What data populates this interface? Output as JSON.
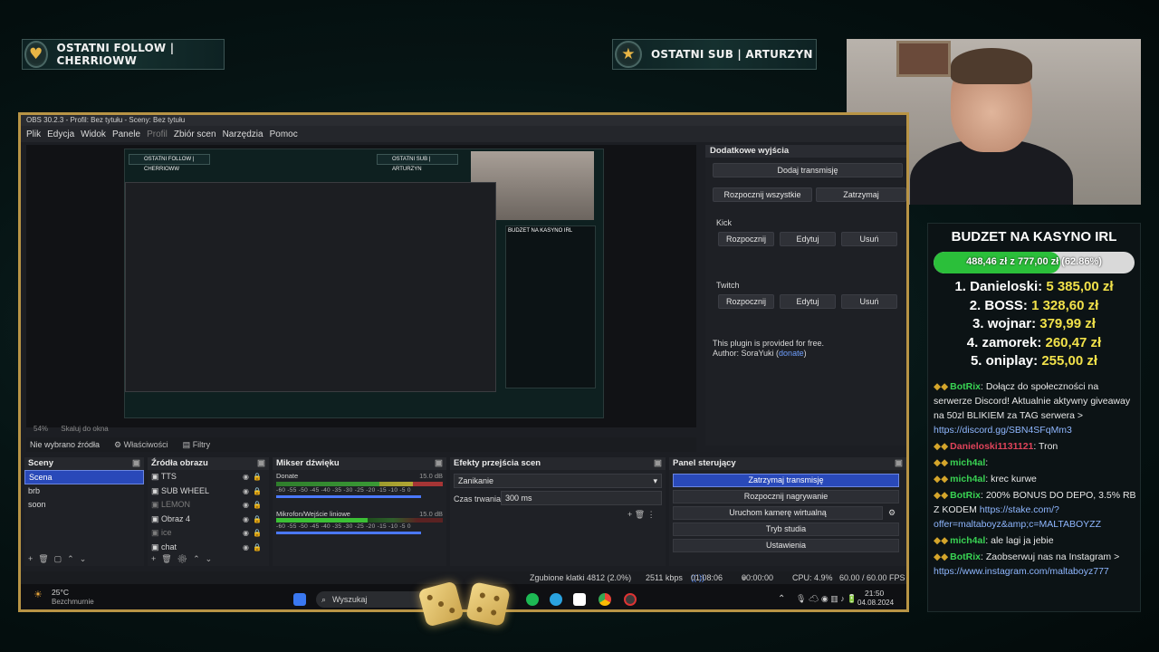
{
  "overlay": {
    "last_follow": "OSTATNI FOLLOW | CHERRIOWW",
    "last_sub": "OSTATNI SUB | ARTURZYN"
  },
  "budget": {
    "title": "BUDZET NA KASYNO IRL",
    "progress_text": "488,46 zł z 777,00 zł (62.86%)",
    "progress_fraction": 0.6286,
    "ranks": [
      {
        "label": "1. Danieloski:",
        "amount": "5 385,00 zł"
      },
      {
        "label": "2. BOSS:",
        "amount": "1 328,60 zł"
      },
      {
        "label": "3. wojnar:",
        "amount": "379,99 zł"
      },
      {
        "label": "4. zamorek:",
        "amount": "260,47 zł"
      },
      {
        "label": "5. oniplay:",
        "amount": "255,00 zł"
      }
    ]
  },
  "chat": [
    {
      "user": "BotRix",
      "user_color": "#39d353",
      "text": ": Dołącz do społeczności na serwerze Discord! Aktualnie aktywny giveaway na 50zl BLIKIEM za TAG serwera >",
      "link": "https://discord.gg/SBN4SFqMm3"
    },
    {
      "user": "Danieloski1131121",
      "user_color": "#e0435a",
      "text": ": Tron",
      "link": ""
    },
    {
      "user": "mich4al",
      "user_color": "#39d353",
      "text": ":",
      "link": ""
    },
    {
      "user": "mich4al",
      "user_color": "#39d353",
      "text": ": krec kurwe",
      "link": ""
    },
    {
      "user": "BotRix",
      "user_color": "#39d353",
      "text": ": 200% BONUS DO DEPO, 3.5% RB Z KODEM",
      "link": "https://stake.com/?offer=maltaboyz&amp;c=MALTABOYZZ"
    },
    {
      "user": "mich4al",
      "user_color": "#39d353",
      "text": ": ale lagi ja jebie",
      "link": ""
    },
    {
      "user": "BotRix",
      "user_color": "#39d353",
      "text": ": Zaobserwuj nas na Instagram >",
      "link": "https://www.instagram.com/maltaboyz777"
    }
  ],
  "obs": {
    "title": "OBS 30.2.3 - Profil: Bez tytułu - Sceny: Bez tytułu",
    "menu": [
      {
        "label": "Plik",
        "dim": false
      },
      {
        "label": "Edycja",
        "dim": false
      },
      {
        "label": "Widok",
        "dim": false
      },
      {
        "label": "Panele",
        "dim": false
      },
      {
        "label": "Profil",
        "dim": true
      },
      {
        "label": "Zbiór scen",
        "dim": false
      },
      {
        "label": "Narzędzia",
        "dim": false
      },
      {
        "label": "Pomoc",
        "dim": false
      }
    ],
    "zoom": "54%",
    "scale_label": "Skaluj do okna",
    "source_bar": {
      "no_source": "Nie wybrano źródła",
      "properties": "Właściwości",
      "filters": "Filtry"
    },
    "extra_outputs": {
      "title": "Dodatkowe wyjścia",
      "add": "Dodaj transmisję",
      "start_all": "Rozpocznij wszystkie",
      "stop_all": "Zatrzymaj",
      "kick_label": "Kick",
      "twitch_label": "Twitch",
      "start": "Rozpocznij",
      "edit": "Edytuj",
      "remove": "Usuń",
      "plugin_note": "This plugin is provided for free.",
      "author": "Author: SoraYuki",
      "donate": "donate"
    },
    "scenes": {
      "title": "Sceny",
      "items": [
        "Scena",
        "brb",
        "soon"
      ],
      "selected": 0
    },
    "sources": {
      "title": "Źródła obrazu",
      "items": [
        {
          "name": "TTS",
          "dim": false
        },
        {
          "name": "SUB WHEEL",
          "dim": false
        },
        {
          "name": "LEMON",
          "dim": true
        },
        {
          "name": "Obraz 4",
          "dim": false
        },
        {
          "name": "ice",
          "dim": true
        },
        {
          "name": "chat",
          "dim": false
        }
      ]
    },
    "mixer": {
      "title": "Mikser dźwięku",
      "channels": [
        {
          "name": "Donate",
          "db": "15.0 dB"
        },
        {
          "name": "Mikrofon/Wejście liniowe",
          "db": "15.0 dB"
        }
      ],
      "scale": "-60 -55 -50 -45 -40 -35 -30 -25 -20 -15 -10 -5 0"
    },
    "transitions": {
      "title": "Efekty przejścia scen",
      "selected": "Zanikanie",
      "duration_label": "Czas trwania",
      "duration": "300 ms"
    },
    "controls": {
      "title": "Panel sterujący",
      "stop_stream": "Zatrzymaj transmisję",
      "start_record": "Rozpocznij nagrywanie",
      "virtual_cam": "Uruchom kamerę wirtualną",
      "studio": "Tryb studia",
      "settings": "Ustawienia"
    },
    "status": {
      "dropped": "Zgubione klatki 4812 (2.0%)",
      "bitrate": "2511 kbps",
      "stream_time": "01:08:06",
      "record_time": "00:00:00",
      "cpu": "CPU: 4.9%",
      "fps": "60.00 / 60.00 FPS"
    },
    "taskbar": {
      "weather_temp": "25°C",
      "weather_desc": "Bezchmurnie",
      "search": "Wyszukaj",
      "time": "21:50",
      "date": "04.08.2024"
    }
  },
  "colors": {
    "accent_gold": "#b89445",
    "obs_selected": "#2949b9",
    "progress_green": "#2bbf3a",
    "amount_yellow": "#f1e14a"
  }
}
